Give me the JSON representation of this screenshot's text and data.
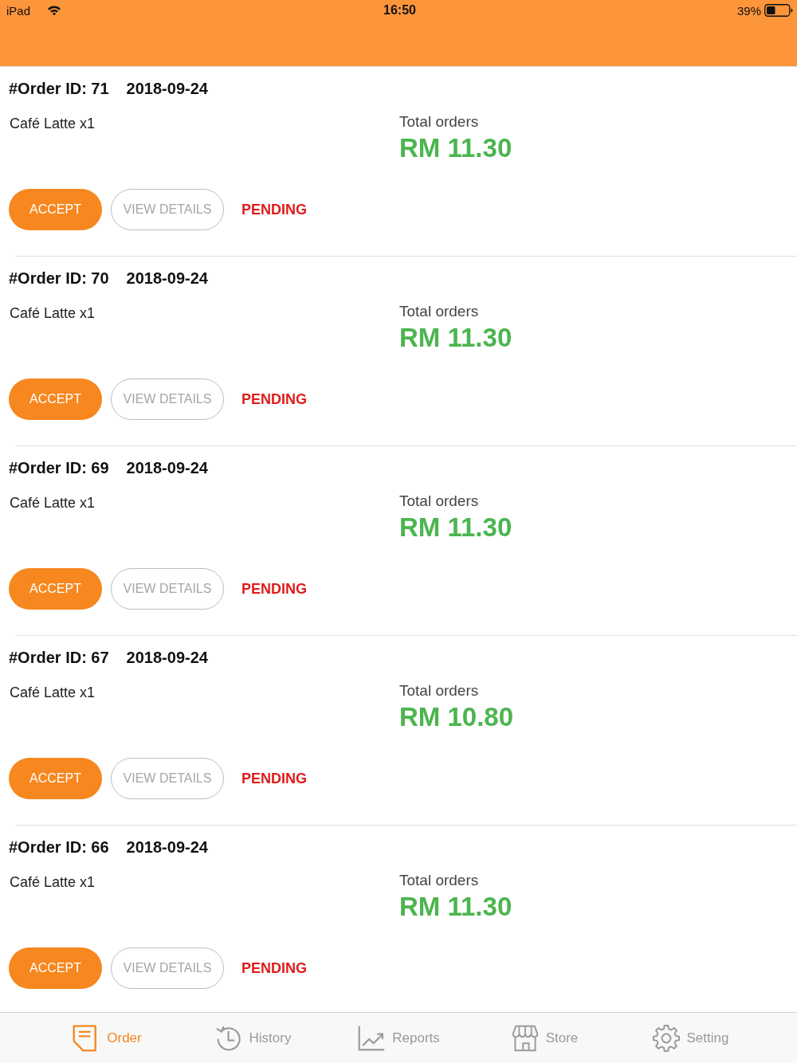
{
  "status_bar": {
    "carrier": "iPad",
    "time": "16:50",
    "battery": "39%"
  },
  "orders": [
    {
      "id_label": "#Order ID: 71",
      "date": "2018-09-24",
      "items": [
        "Café Latte x1"
      ],
      "total_label": "Total orders",
      "total": "RM 11.30",
      "accept": "ACCEPT",
      "view": "VIEW DETAILS",
      "status": "PENDING"
    },
    {
      "id_label": "#Order ID: 70",
      "date": "2018-09-24",
      "items": [
        "Café Latte x1"
      ],
      "total_label": "Total orders",
      "total": "RM 11.30",
      "accept": "ACCEPT",
      "view": "VIEW DETAILS",
      "status": "PENDING"
    },
    {
      "id_label": "#Order ID: 69",
      "date": "2018-09-24",
      "items": [
        "Café Latte x1"
      ],
      "total_label": "Total orders",
      "total": "RM 11.30",
      "accept": "ACCEPT",
      "view": "VIEW DETAILS",
      "status": "PENDING"
    },
    {
      "id_label": "#Order ID: 67",
      "date": "2018-09-24",
      "items": [
        "Café Latte x1"
      ],
      "total_label": "Total orders",
      "total": "RM 10.80",
      "accept": "ACCEPT",
      "view": "VIEW DETAILS",
      "status": "PENDING"
    },
    {
      "id_label": "#Order ID: 66",
      "date": "2018-09-24",
      "items": [
        "Café Latte x1"
      ],
      "total_label": "Total orders",
      "total": "RM 11.30",
      "accept": "ACCEPT",
      "view": "VIEW DETAILS",
      "status": "PENDING"
    }
  ],
  "tabs": [
    {
      "label": "Order",
      "kind": "order",
      "selected": true
    },
    {
      "label": "History",
      "kind": "history",
      "selected": false
    },
    {
      "label": "Reports",
      "kind": "reports",
      "selected": false
    },
    {
      "label": "Store",
      "kind": "store",
      "selected": false
    },
    {
      "label": "Setting",
      "kind": "setting",
      "selected": false
    }
  ]
}
